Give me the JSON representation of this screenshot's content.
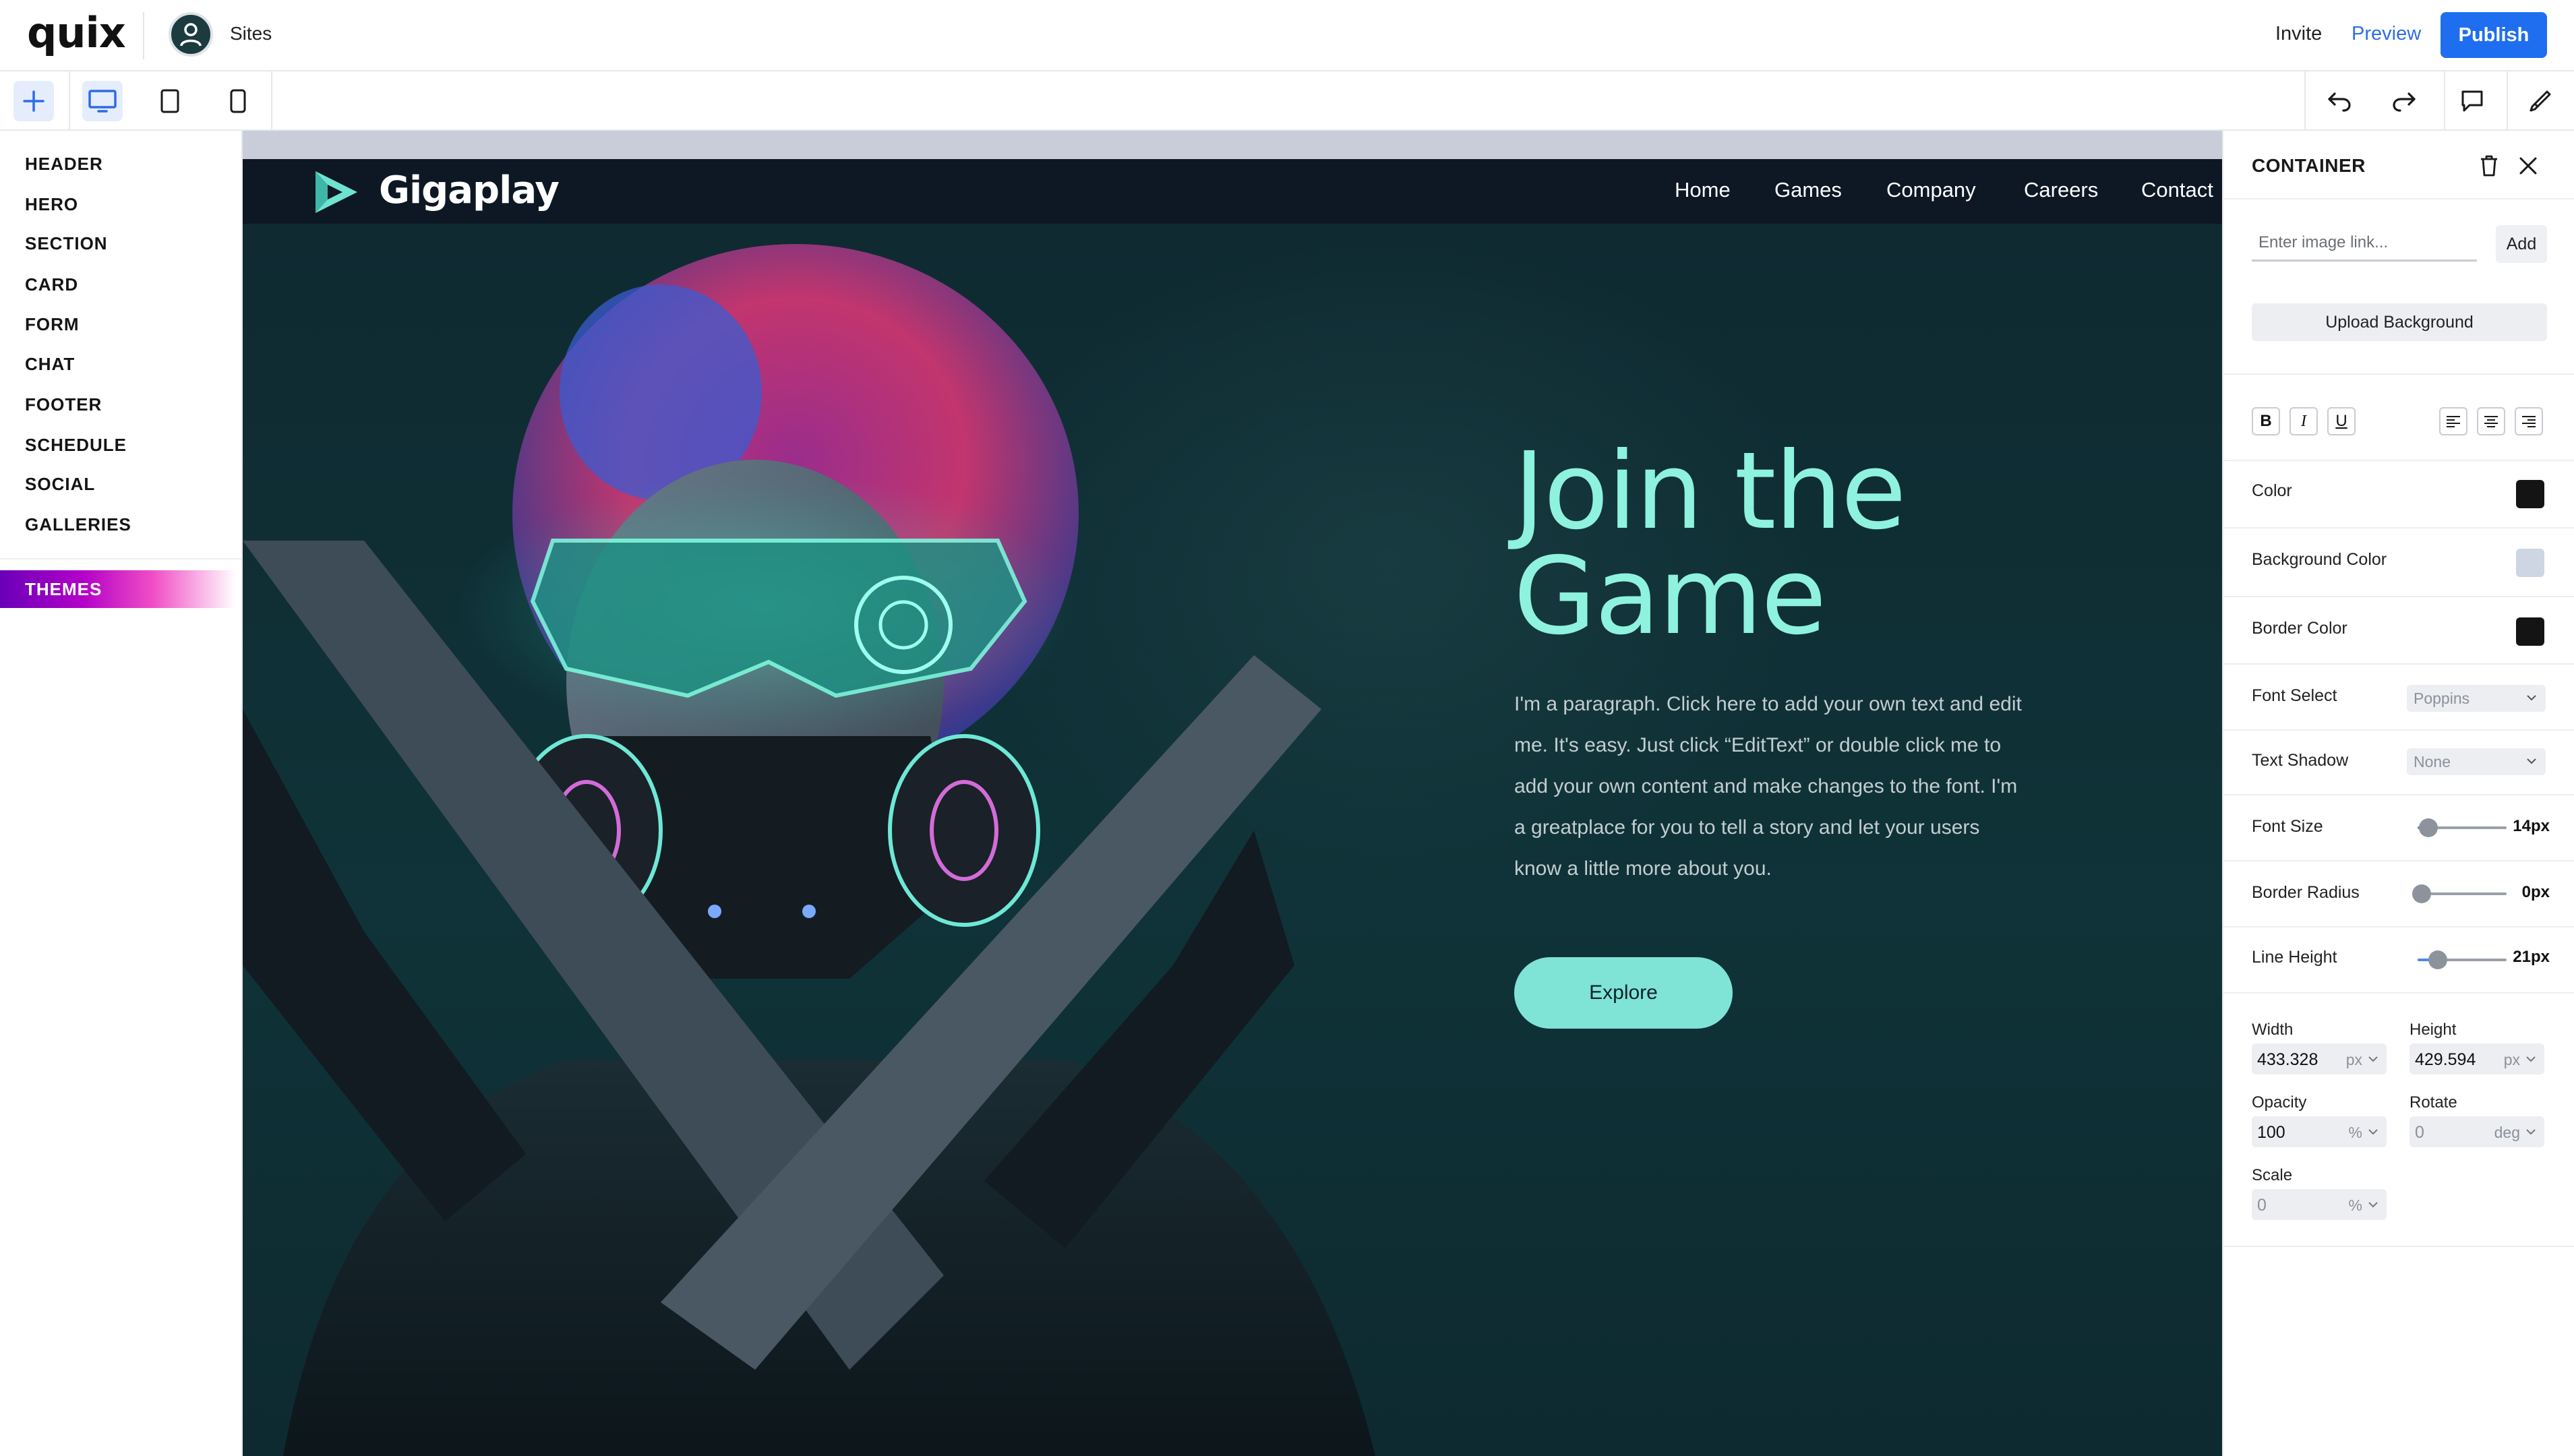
{
  "app": {
    "logo": "quix",
    "sites_label": "Sites"
  },
  "topbar": {
    "invite": "Invite",
    "preview": "Preview",
    "publish": "Publish"
  },
  "sidebar": {
    "items": [
      "HEADER",
      "HERO",
      "SECTION",
      "CARD",
      "FORM",
      "CHAT",
      "FOOTER",
      "SCHEDULE",
      "SOCIAL",
      "GALLERIES"
    ],
    "themes": "THEMES"
  },
  "site": {
    "brand": "Gigaplay",
    "nav": [
      "Home",
      "Games",
      "Company",
      "Careers",
      "Contact"
    ],
    "hero_title_line1": "Join the",
    "hero_title_line2": "Game",
    "hero_paragraph": "I'm a paragraph. Click here to add your own text and edit me. It's easy. Just click “EditText” or double click me to add your own content and make changes to the font. I'm a greatplace for you to tell a story and let your users know a little more about you.",
    "cta": "Explore"
  },
  "panel": {
    "title": "CONTAINER",
    "image_placeholder": "Enter image link...",
    "add": "Add",
    "upload": "Upload Background",
    "format_buttons": [
      "B",
      "I",
      "U"
    ],
    "color_label": "Color",
    "bg_color_label": "Background Color",
    "border_color_label": "Border Color",
    "font_select_label": "Font Select",
    "font_select_value": "Poppins",
    "text_shadow_label": "Text Shadow",
    "text_shadow_value": "None",
    "font_size_label": "Font Size",
    "font_size_value": "14px",
    "border_radius_label": "Border Radius",
    "border_radius_value": "0px",
    "line_height_label": "Line Height",
    "line_height_value": "21px",
    "width_label": "Width",
    "width_value": "433.328",
    "width_unit": "px",
    "height_label": "Height",
    "height_value": "429.594",
    "height_unit": "px",
    "opacity_label": "Opacity",
    "opacity_value": "100",
    "opacity_unit": "%",
    "rotate_label": "Rotate",
    "rotate_value": "0",
    "rotate_unit": "deg",
    "scale_label": "Scale",
    "scale_value": "0",
    "scale_unit": "%"
  },
  "colors": {
    "accent": "#1f6ef0",
    "hero_title": "#8ef2de",
    "cta_bg": "#7fe3d6",
    "swatch_color": "#141414",
    "swatch_background": "#cdd6e2",
    "swatch_border": "#141414"
  },
  "icons": {
    "toolbar": [
      "plus-icon",
      "desktop-icon",
      "tablet-icon",
      "mobile-icon",
      "undo-icon",
      "redo-icon",
      "comment-icon",
      "brush-icon"
    ],
    "panel": [
      "trash-icon",
      "close-icon"
    ]
  }
}
